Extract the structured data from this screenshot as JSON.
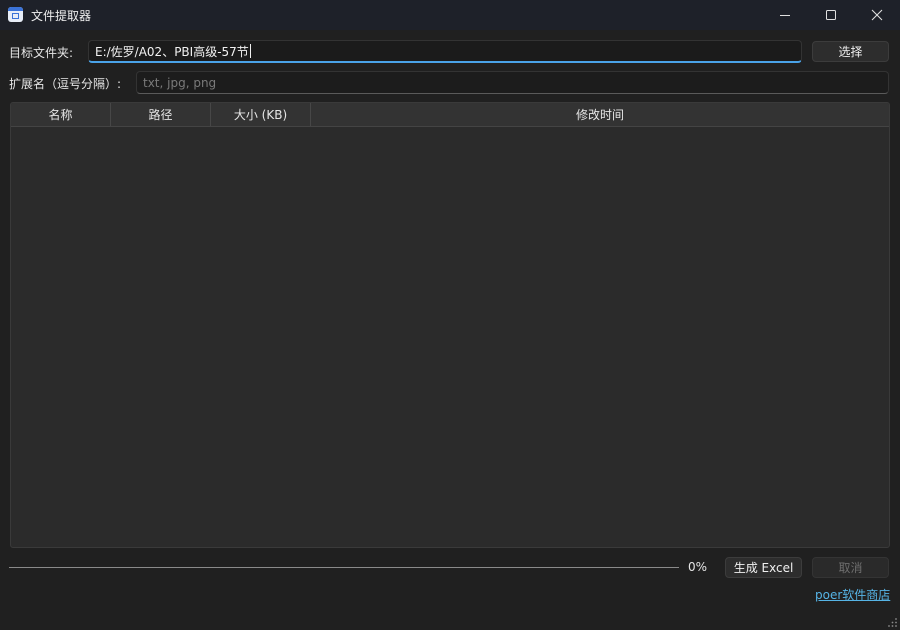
{
  "window": {
    "title": "文件提取器",
    "icon": "app-window-icon",
    "controls": {
      "minimize": "minimize-icon",
      "maximize": "maximize-icon",
      "close": "close-icon"
    }
  },
  "folder": {
    "label": "目标文件夹:",
    "value": "E:/佐罗/A02、PBI高级-57节",
    "browse_label": "选择"
  },
  "extensions": {
    "label": "扩展名（逗号分隔）:",
    "value": "",
    "placeholder": "txt, jpg, png"
  },
  "table": {
    "columns": [
      "名称",
      "路径",
      "大小 (KB)",
      "修改时间"
    ],
    "rows": []
  },
  "progress": {
    "value_fraction": 0,
    "text": "0%"
  },
  "actions": {
    "generate_label": "生成 Excel",
    "cancel_label": "取消"
  },
  "footer": {
    "link_text": "poer软件商店"
  },
  "colors": {
    "accent": "#4aa3e8",
    "link": "#56b4e6",
    "background": "#202020",
    "titlebar": "#1e2129"
  }
}
